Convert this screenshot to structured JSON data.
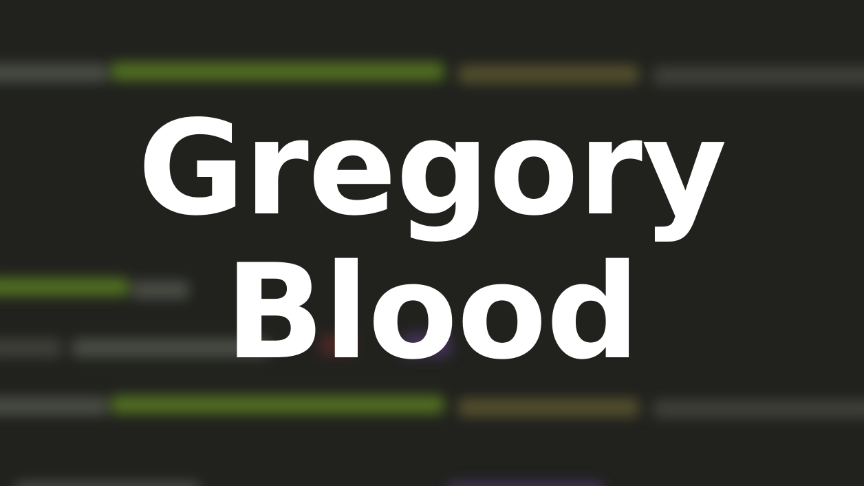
{
  "hero": {
    "name_line1": "Gregory",
    "name_line2": "Blood"
  },
  "colors": {
    "background": "#252622",
    "text": "#ffffff",
    "code_green": "#78aa28",
    "code_olive": "#a0963f",
    "code_gray": "#96968c",
    "code_purple": "#7850aa"
  }
}
